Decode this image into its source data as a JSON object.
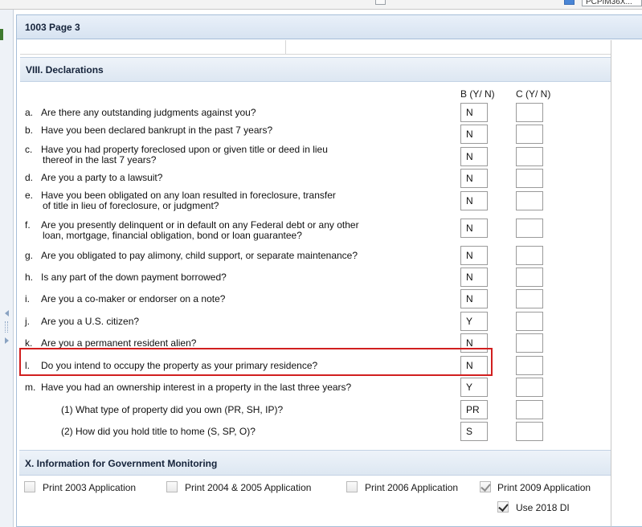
{
  "topbar": {
    "field_value": "PCPIM36X..."
  },
  "panel": {
    "title": "1003 Page 3"
  },
  "declarations": {
    "header": "VIII. Declarations",
    "col_b": "B (Y/ N)",
    "col_c": "C (Y/ N)",
    "questions": [
      {
        "letter": "a.",
        "text": "Are there any outstanding judgments against you?",
        "b": "N",
        "c": ""
      },
      {
        "letter": "b.",
        "text": "Have you been declared bankrupt in the past 7 years?",
        "b": "N",
        "c": ""
      },
      {
        "letter": "c.",
        "text": "Have you had property foreclosed upon or given title or deed in lieu thereof in the last 7 years?",
        "line1": "Have you had property foreclosed upon or given title or deed in lieu",
        "line2": "thereof in the last 7 years?",
        "b": "N",
        "c": ""
      },
      {
        "letter": "d.",
        "text": "Are you a party to a lawsuit?",
        "b": "N",
        "c": ""
      },
      {
        "letter": "e.",
        "text": "Have you been obligated on any loan resulted in foreclosure, transfer of title in lieu of foreclosure, or judgment?",
        "line1": "Have you been obligated on any loan resulted in foreclosure, transfer",
        "line2": "of title in lieu of foreclosure, or judgment?",
        "b": "N",
        "c": ""
      },
      {
        "letter": "f.",
        "text": "Are you presently delinquent or in default on any Federal debt or any other loan, mortgage, financial obligation, bond or loan guarantee?",
        "line1": "Are you presently delinquent or in default on any Federal debt or any other",
        "line2": "loan, mortgage, financial obligation, bond or loan guarantee?",
        "b": "N",
        "c": ""
      },
      {
        "letter": "g.",
        "text": "Are you obligated to pay alimony, child support, or separate maintenance?",
        "b": "N",
        "c": ""
      },
      {
        "letter": "h.",
        "text": "Is any part of the down payment borrowed?",
        "b": "N",
        "c": ""
      },
      {
        "letter": "i.",
        "text": "Are you a co-maker or endorser on a note?",
        "b": "N",
        "c": ""
      },
      {
        "letter": "j.",
        "text": "Are you a U.S. citizen?",
        "b": "Y",
        "c": ""
      },
      {
        "letter": "k.",
        "text": "Are you a permanent resident alien?",
        "b": "N",
        "c": ""
      },
      {
        "letter": "l.",
        "text": "Do you intend to occupy the property as your primary residence?",
        "b": "N",
        "c": ""
      },
      {
        "letter": "m.",
        "text": "Have you had an ownership interest in a property in the last three years?",
        "b": "Y",
        "c": ""
      },
      {
        "letter": "",
        "text": "(1) What type of property did you own (PR, SH, IP)?",
        "b": "PR",
        "c": ""
      },
      {
        "letter": "",
        "text": "(2) How did you hold title to home (S, SP, O)?",
        "b": "S",
        "c": ""
      }
    ]
  },
  "monitoring": {
    "header": "X. Information for Government Monitoring",
    "options": [
      {
        "label": "Print 2003 Application",
        "checked": false
      },
      {
        "label": "Print 2004 & 2005 Application",
        "checked": false
      },
      {
        "label": "Print 2006 Application",
        "checked": false
      },
      {
        "label": "Print 2009 Application",
        "checked": true
      },
      {
        "label": "Use 2018 DI",
        "checked": true
      }
    ]
  }
}
